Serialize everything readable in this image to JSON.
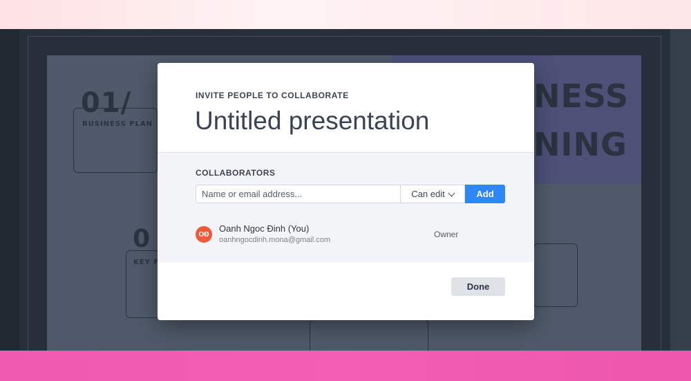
{
  "modal": {
    "eyebrow": "INVITE PEOPLE TO COLLABORATE",
    "title": "Untitled presentation",
    "collaborators_label": "COLLABORATORS",
    "email_placeholder": "Name or email address...",
    "permission": "Can edit",
    "add_label": "Add",
    "collaborators": [
      {
        "initials": "OĐ",
        "name": "Oanh Ngoc Đinh (You)",
        "email": "oanhngocdinh.mona@gmail.com",
        "role": "Owner",
        "avatar_color": "#ef5a3a"
      }
    ],
    "done_label": "Done"
  },
  "background": {
    "slide_texts": {
      "number_1": "01/",
      "heading_1": "BUSINESS PLAN",
      "number_2": "0",
      "heading_2": "KEY F",
      "big_1": "NESS",
      "big_2": "NING"
    }
  },
  "colors": {
    "accent": "#2f86f6",
    "top_banner": "#fde1e4",
    "bottom_banner": "#f05ab0"
  }
}
